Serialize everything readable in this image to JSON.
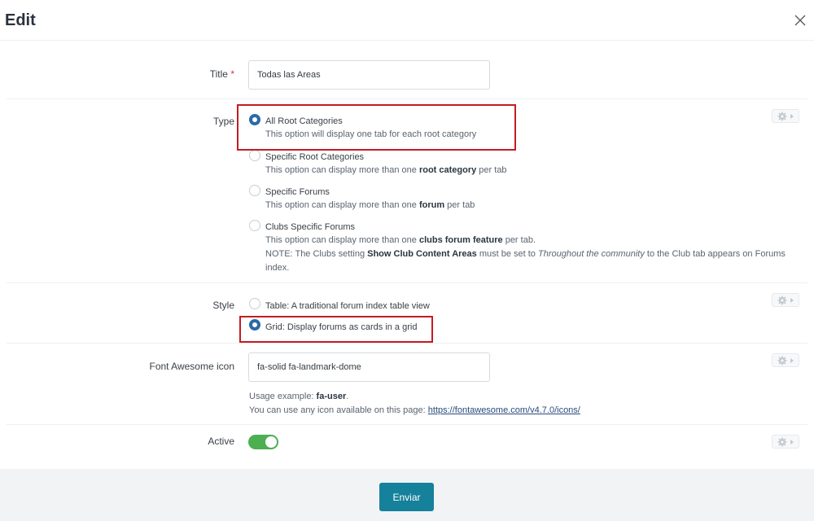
{
  "dialog": {
    "title": "Edit"
  },
  "fields": {
    "title": {
      "label": "Title",
      "required_mark": "*",
      "value": "Todas las Areas"
    },
    "type": {
      "label": "Type",
      "options": [
        {
          "title": "All Root Categories",
          "selected": true,
          "desc_parts": [
            "This option will display one tab for each root category"
          ]
        },
        {
          "title": "Specific Root Categories",
          "selected": false,
          "desc_parts": [
            "This option can display more than one ",
            "root category",
            " per tab"
          ]
        },
        {
          "title": "Specific Forums",
          "selected": false,
          "desc_parts": [
            "This option can display more than one ",
            "forum",
            " per tab"
          ]
        },
        {
          "title": "Clubs Specific Forums",
          "selected": false,
          "desc_parts": [
            "This option can display more than one ",
            "clubs forum feature",
            " per tab."
          ],
          "note_parts": [
            "NOTE: The Clubs setting ",
            "Show Club Content Areas",
            " must be set to ",
            "Throughout the community",
            " to the Club tab appears on Forums index."
          ]
        }
      ]
    },
    "style": {
      "label": "Style",
      "options": [
        {
          "title": "Table: A traditional forum index table view",
          "selected": false
        },
        {
          "title": "Grid: Display forums as cards in a grid",
          "selected": true
        }
      ]
    },
    "icon": {
      "label": "Font Awesome icon",
      "value": "fa-solid fa-landmark-dome",
      "usage_prefix": "Usage example: ",
      "usage_example": "fa-user",
      "usage_suffix": ".",
      "link_prefix": "You can use any icon available on this page: ",
      "link_text": "https://fontawesome.com/v4.7.0/icons/"
    },
    "active": {
      "label": "Active",
      "on": true
    }
  },
  "footer": {
    "submit_label": "Enviar"
  },
  "colors": {
    "accent": "#16819a",
    "toggle_on": "#4caf50",
    "radio_checked": "#2b6aa6",
    "highlight": "#c41c24"
  },
  "icons": {
    "close": "close-icon",
    "gear": "gear-icon"
  }
}
